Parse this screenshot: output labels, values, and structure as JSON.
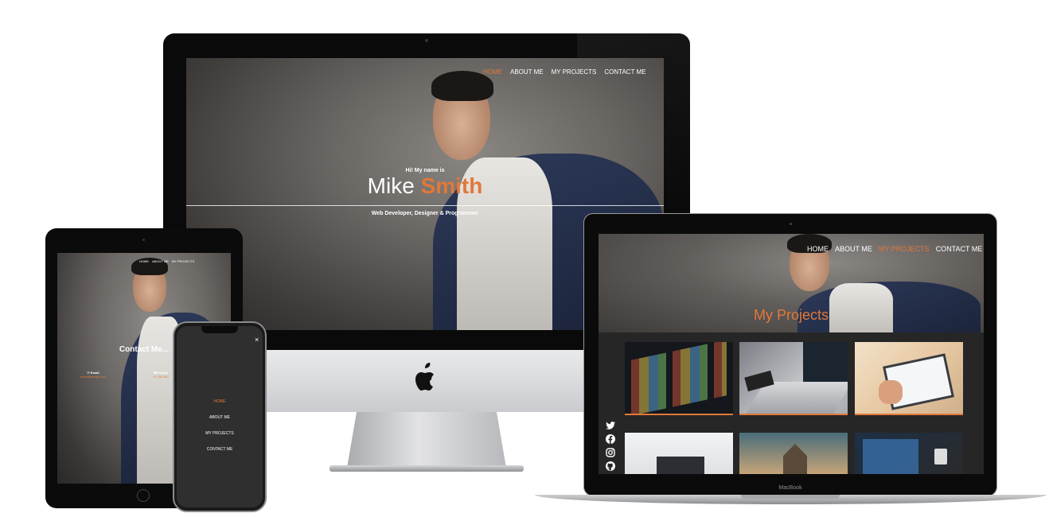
{
  "accent_color": "#e2783a",
  "imac": {
    "nav": [
      "HOME",
      "ABOUT ME",
      "MY PROJECTS",
      "CONTACT ME"
    ],
    "active_nav": "HOME",
    "hero_greeting": "Hi! My name is",
    "hero_first_name": "Mike",
    "hero_last_name": "Smith",
    "hero_tagline": "Web Developer, Designer & Programmer"
  },
  "ipad": {
    "nav": [
      "HOME",
      "ABOUT ME",
      "MY PROJECTS"
    ],
    "section_title": "Contact Me...",
    "email_label": "Email",
    "email_value": "email@email.com",
    "phone_label": "Phone",
    "phone_value": "+1 234 567"
  },
  "iphone": {
    "menu": [
      "HOME",
      "ABOUT ME",
      "MY PROJECTS",
      "CONTACT ME"
    ],
    "active_menu": "HOME",
    "close_icon": "×"
  },
  "macbook": {
    "nav": [
      "HOME",
      "ABOUT ME",
      "MY PROJECTS",
      "CONTACT ME"
    ],
    "active_nav": "MY PROJECTS",
    "section_title": "My Projects",
    "device_label": "MacBook",
    "social_icons": [
      "twitter-icon",
      "facebook-icon",
      "instagram-icon",
      "github-icon"
    ]
  }
}
